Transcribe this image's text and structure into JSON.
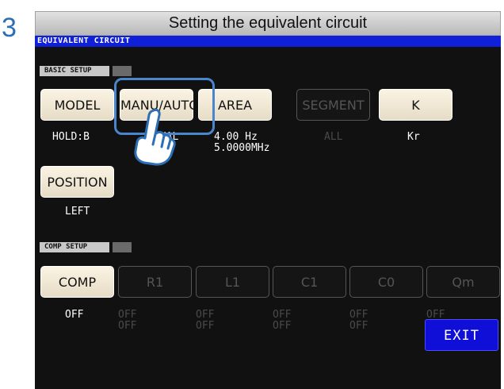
{
  "step": "3",
  "heading": "Setting the equivalent circuit",
  "screen": {
    "title": "EQUIVALENT CIRCUIT",
    "basic_setup": {
      "label": "BASIC SETUP",
      "model": {
        "label": "MODEL",
        "value": "HOLD:B"
      },
      "manu_auto": {
        "label": "MANU/AUTO",
        "value": "DUAL"
      },
      "area": {
        "label": "AREA",
        "value": "4.00 Hz\n5.0000MHz"
      },
      "segment": {
        "label": "SEGMENT",
        "value": "ALL"
      },
      "k": {
        "label": "K",
        "value": "Kr"
      },
      "position": {
        "label": "POSITION",
        "value": "LEFT"
      }
    },
    "comp_setup": {
      "label": "COMP SETUP",
      "buttons": [
        {
          "label": "COMP",
          "value": "OFF"
        },
        {
          "label": "R1",
          "value": "OFF\nOFF"
        },
        {
          "label": "L1",
          "value": "OFF\nOFF"
        },
        {
          "label": "C1",
          "value": "OFF\nOFF"
        },
        {
          "label": "C0",
          "value": "OFF\nOFF"
        },
        {
          "label": "Qm",
          "value": "OFF\nOFF"
        }
      ]
    },
    "exit_label": "EXIT"
  },
  "colors": {
    "title_bar": "#1020d8",
    "exit_button": "#0f0fd8",
    "highlight": "#4a86cc",
    "step_number": "#2d6fb4"
  },
  "icons": {
    "pointer": "pointing-hand-icon"
  }
}
